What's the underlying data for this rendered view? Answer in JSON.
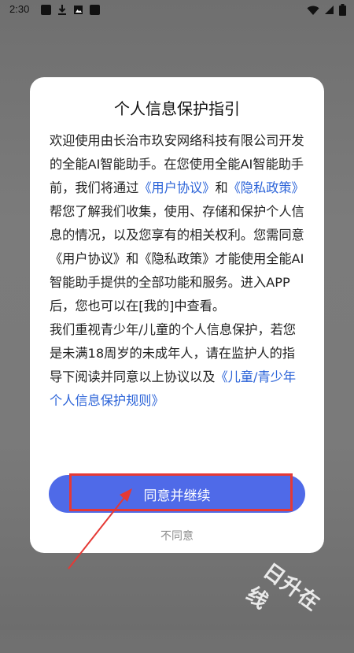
{
  "status_bar": {
    "time": "2:30"
  },
  "dialog": {
    "title": "个人信息保护指引",
    "paragraph1_a": "欢迎使用由长治市玖安网络科技有限公司开发的全能AI智能助手。在您使用全能AI智能助手前，我们将通过",
    "link_user_agreement": "《用户协议》",
    "paragraph1_b": "和",
    "link_privacy_policy": "《隐私政策》",
    "paragraph1_c": "帮您了解我们收集，使用、存储和保护个人信息的情况，以及您享有的相关权利。您需同意《用户协议》和《隐私政策》才能使用全能AI智能助手提供的全部功能和服务。进入APP后，您也可以在[我的]中查看。",
    "paragraph2": "我们重视青少年/儿童的个人信息保护，若您是未满18周岁的未成年人，请在监护人的指导下阅读并同意以上协议以及",
    "link_child_rules": "《儿童/青少年个人信息保护规则》",
    "agree_button": "同意并继续",
    "disagree_button": "不同意"
  },
  "watermark": {
    "text": "日升在线"
  },
  "colors": {
    "primary_button": "#4f6ae8",
    "link": "#2b63d8",
    "annotation_red": "#e53935"
  }
}
